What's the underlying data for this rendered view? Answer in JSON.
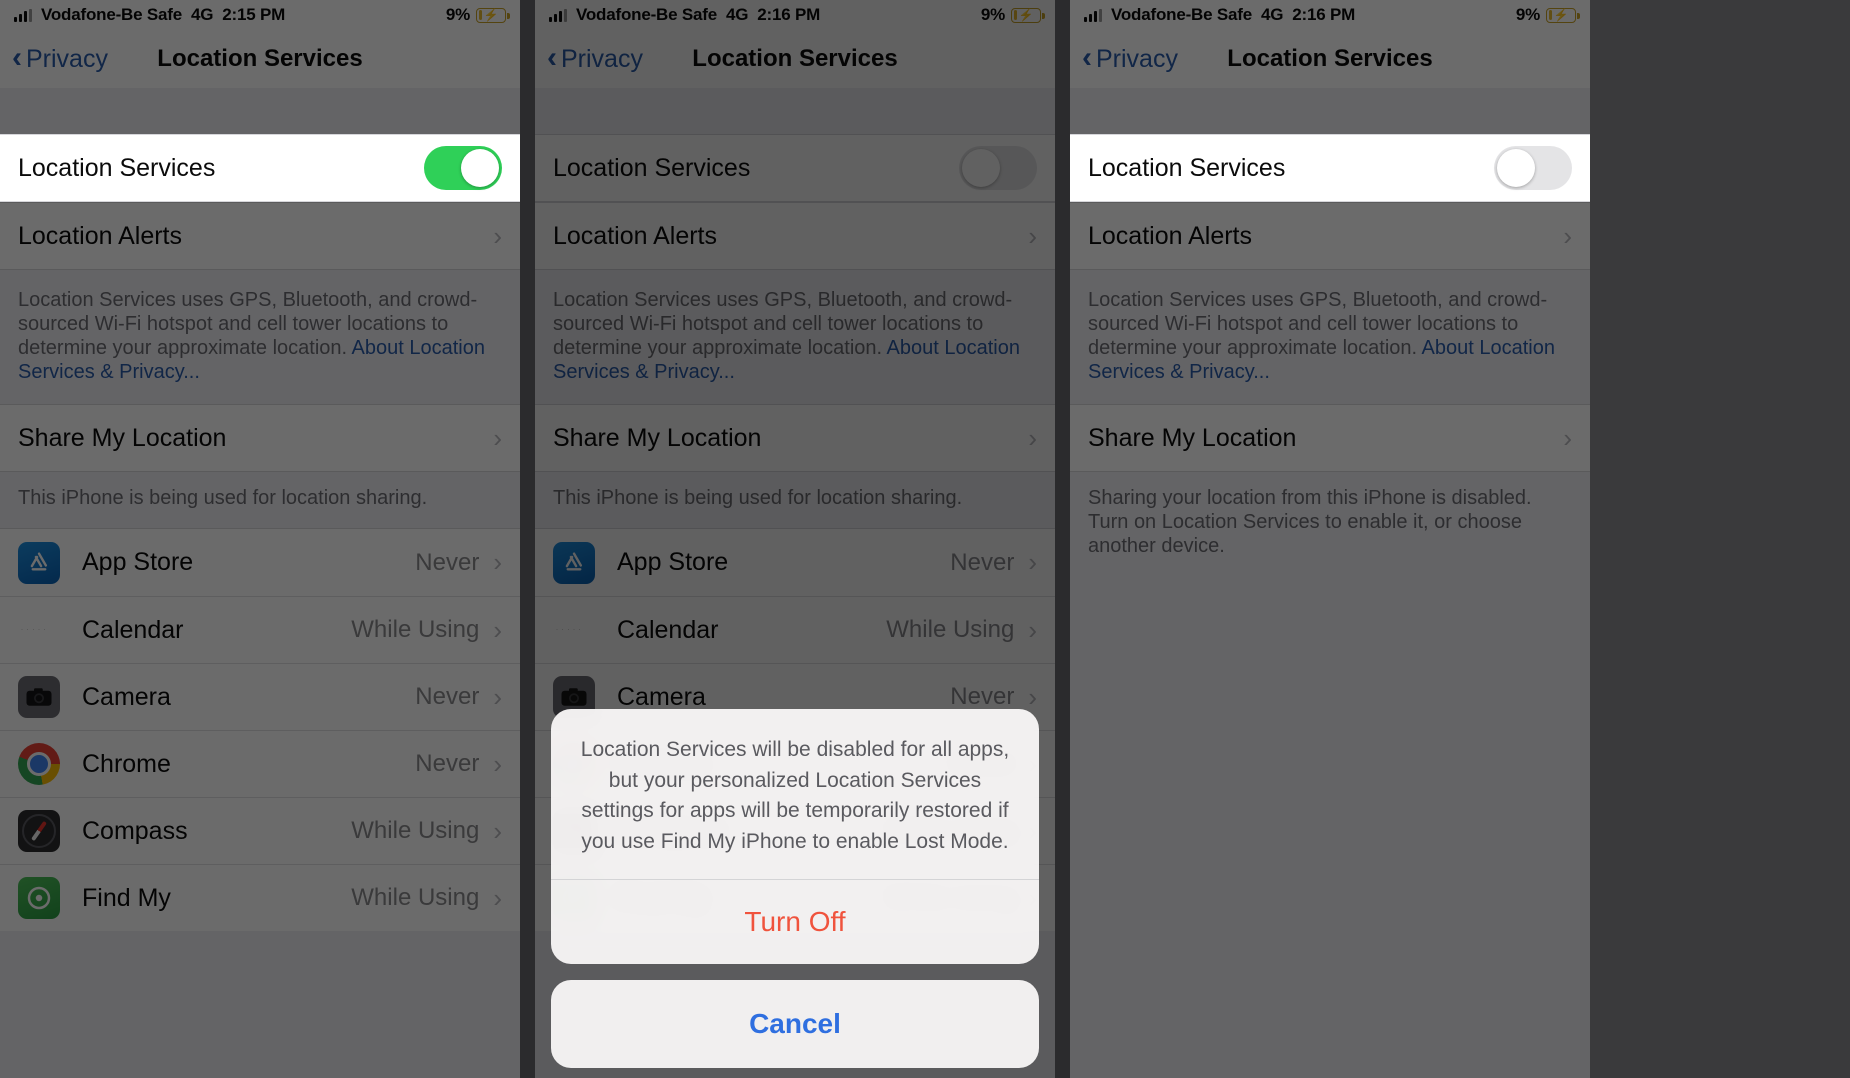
{
  "statusbar": {
    "carrier": "Vodafone-Be Safe",
    "network": "4G",
    "time_1": "2:15 PM",
    "time_2": "2:16 PM",
    "time_3": "2:16 PM",
    "battery_percent": "9%",
    "battery_color": "#e8b931",
    "charging_icon": "bolt-icon",
    "signal_icon": "cellular-bars-icon"
  },
  "nav": {
    "back_label": "Privacy",
    "back_icon": "chevron-left-icon",
    "title": "Location Services",
    "accent_color": "#2a5caa"
  },
  "rows": {
    "location_services_label": "Location Services",
    "location_alerts_label": "Location Alerts",
    "share_my_location_label": "Share My Location",
    "chevron": "›"
  },
  "toggle": {
    "on_color": "#2fd058",
    "off_color": "#e4e4e6",
    "state_panel1": "on",
    "state_panel2": "off",
    "state_panel3": "off"
  },
  "footnotes": {
    "about_text": "Location Services uses GPS, Bluetooth, and crowd-sourced Wi-Fi hotspot and cell tower locations to determine your approximate location. ",
    "about_link": "About Location Services & Privacy...",
    "sharing_enabled": "This iPhone is being used for location sharing.",
    "sharing_disabled": "Sharing your location from this iPhone is disabled. Turn on Location Services to enable it, or choose another device."
  },
  "apps": [
    {
      "name": "App Store",
      "value": "Never",
      "icon": "app-store-icon"
    },
    {
      "name": "Calendar",
      "value": "While Using",
      "icon": "calendar-icon"
    },
    {
      "name": "Camera",
      "value": "Never",
      "icon": "camera-icon"
    },
    {
      "name": "Chrome",
      "value": "Never",
      "icon": "chrome-icon"
    },
    {
      "name": "Compass",
      "value": "While Using",
      "icon": "compass-icon"
    },
    {
      "name": "Find My",
      "value": "While Using",
      "icon": "find-my-icon"
    }
  ],
  "alert": {
    "message": "Location Services will be disabled for all apps, but your personalized Location Services settings for apps will be temporarily restored if you use Find My iPhone to enable Lost Mode.",
    "turn_off_label": "Turn Off",
    "turn_off_color": "#f0533d",
    "cancel_label": "Cancel",
    "cancel_color": "#2f6fe0"
  }
}
